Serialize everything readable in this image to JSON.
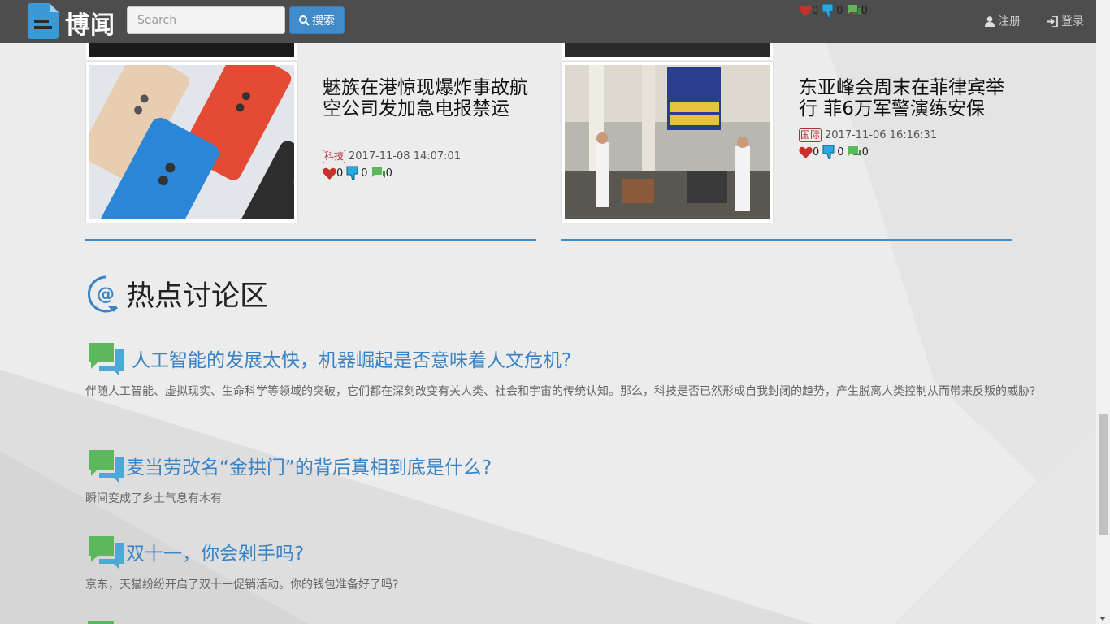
{
  "nav": {
    "brand": "博闻",
    "search_placeholder": "Search",
    "search_label": "搜索",
    "register_label": "注册",
    "login_label": "登录"
  },
  "top_stats": {
    "likes": "0",
    "dislikes": "0",
    "comments": "0"
  },
  "news": [
    {
      "title": "魅族在港惊现爆炸事故航空公司发加急电报禁运",
      "tag": "科技",
      "date": "2017-11-08 14:07:01",
      "likes": "0",
      "dislikes": "0",
      "comments": "0"
    },
    {
      "title": "东亚峰会周末在菲律宾举行 菲6万军警演练安保",
      "tag": "国际",
      "date": "2017-11-06 16:16:31",
      "likes": "0",
      "dislikes": "0",
      "comments": "0"
    }
  ],
  "discussion": {
    "section_title": "热点讨论区",
    "topics": [
      {
        "title": "人工智能的发展太快，机器崛起是否意味着人文危机?",
        "desc": "伴随人工智能、虚拟现实、生命科学等领域的突破，它们都在深刻改变有关人类、社会和宇宙的传统认知。那么，科技是否已然形成自我封闭的趋势，产生脱离人类控制从而带来反叛的威胁?"
      },
      {
        "title": "麦当劳改名“金拱门”的背后真相到底是什么?",
        "desc": "瞬间变成了乡土气息有木有"
      },
      {
        "title": "双十一，你会剁手吗?",
        "desc": "京东，天猫纷纷开启了双十一促销活动。你的钱包准备好了吗?"
      }
    ]
  },
  "colors": {
    "accent": "#428bca",
    "topic_title": "#3a83c4",
    "tag_red": "#b0302e",
    "navbar": "#4d4d4d"
  }
}
